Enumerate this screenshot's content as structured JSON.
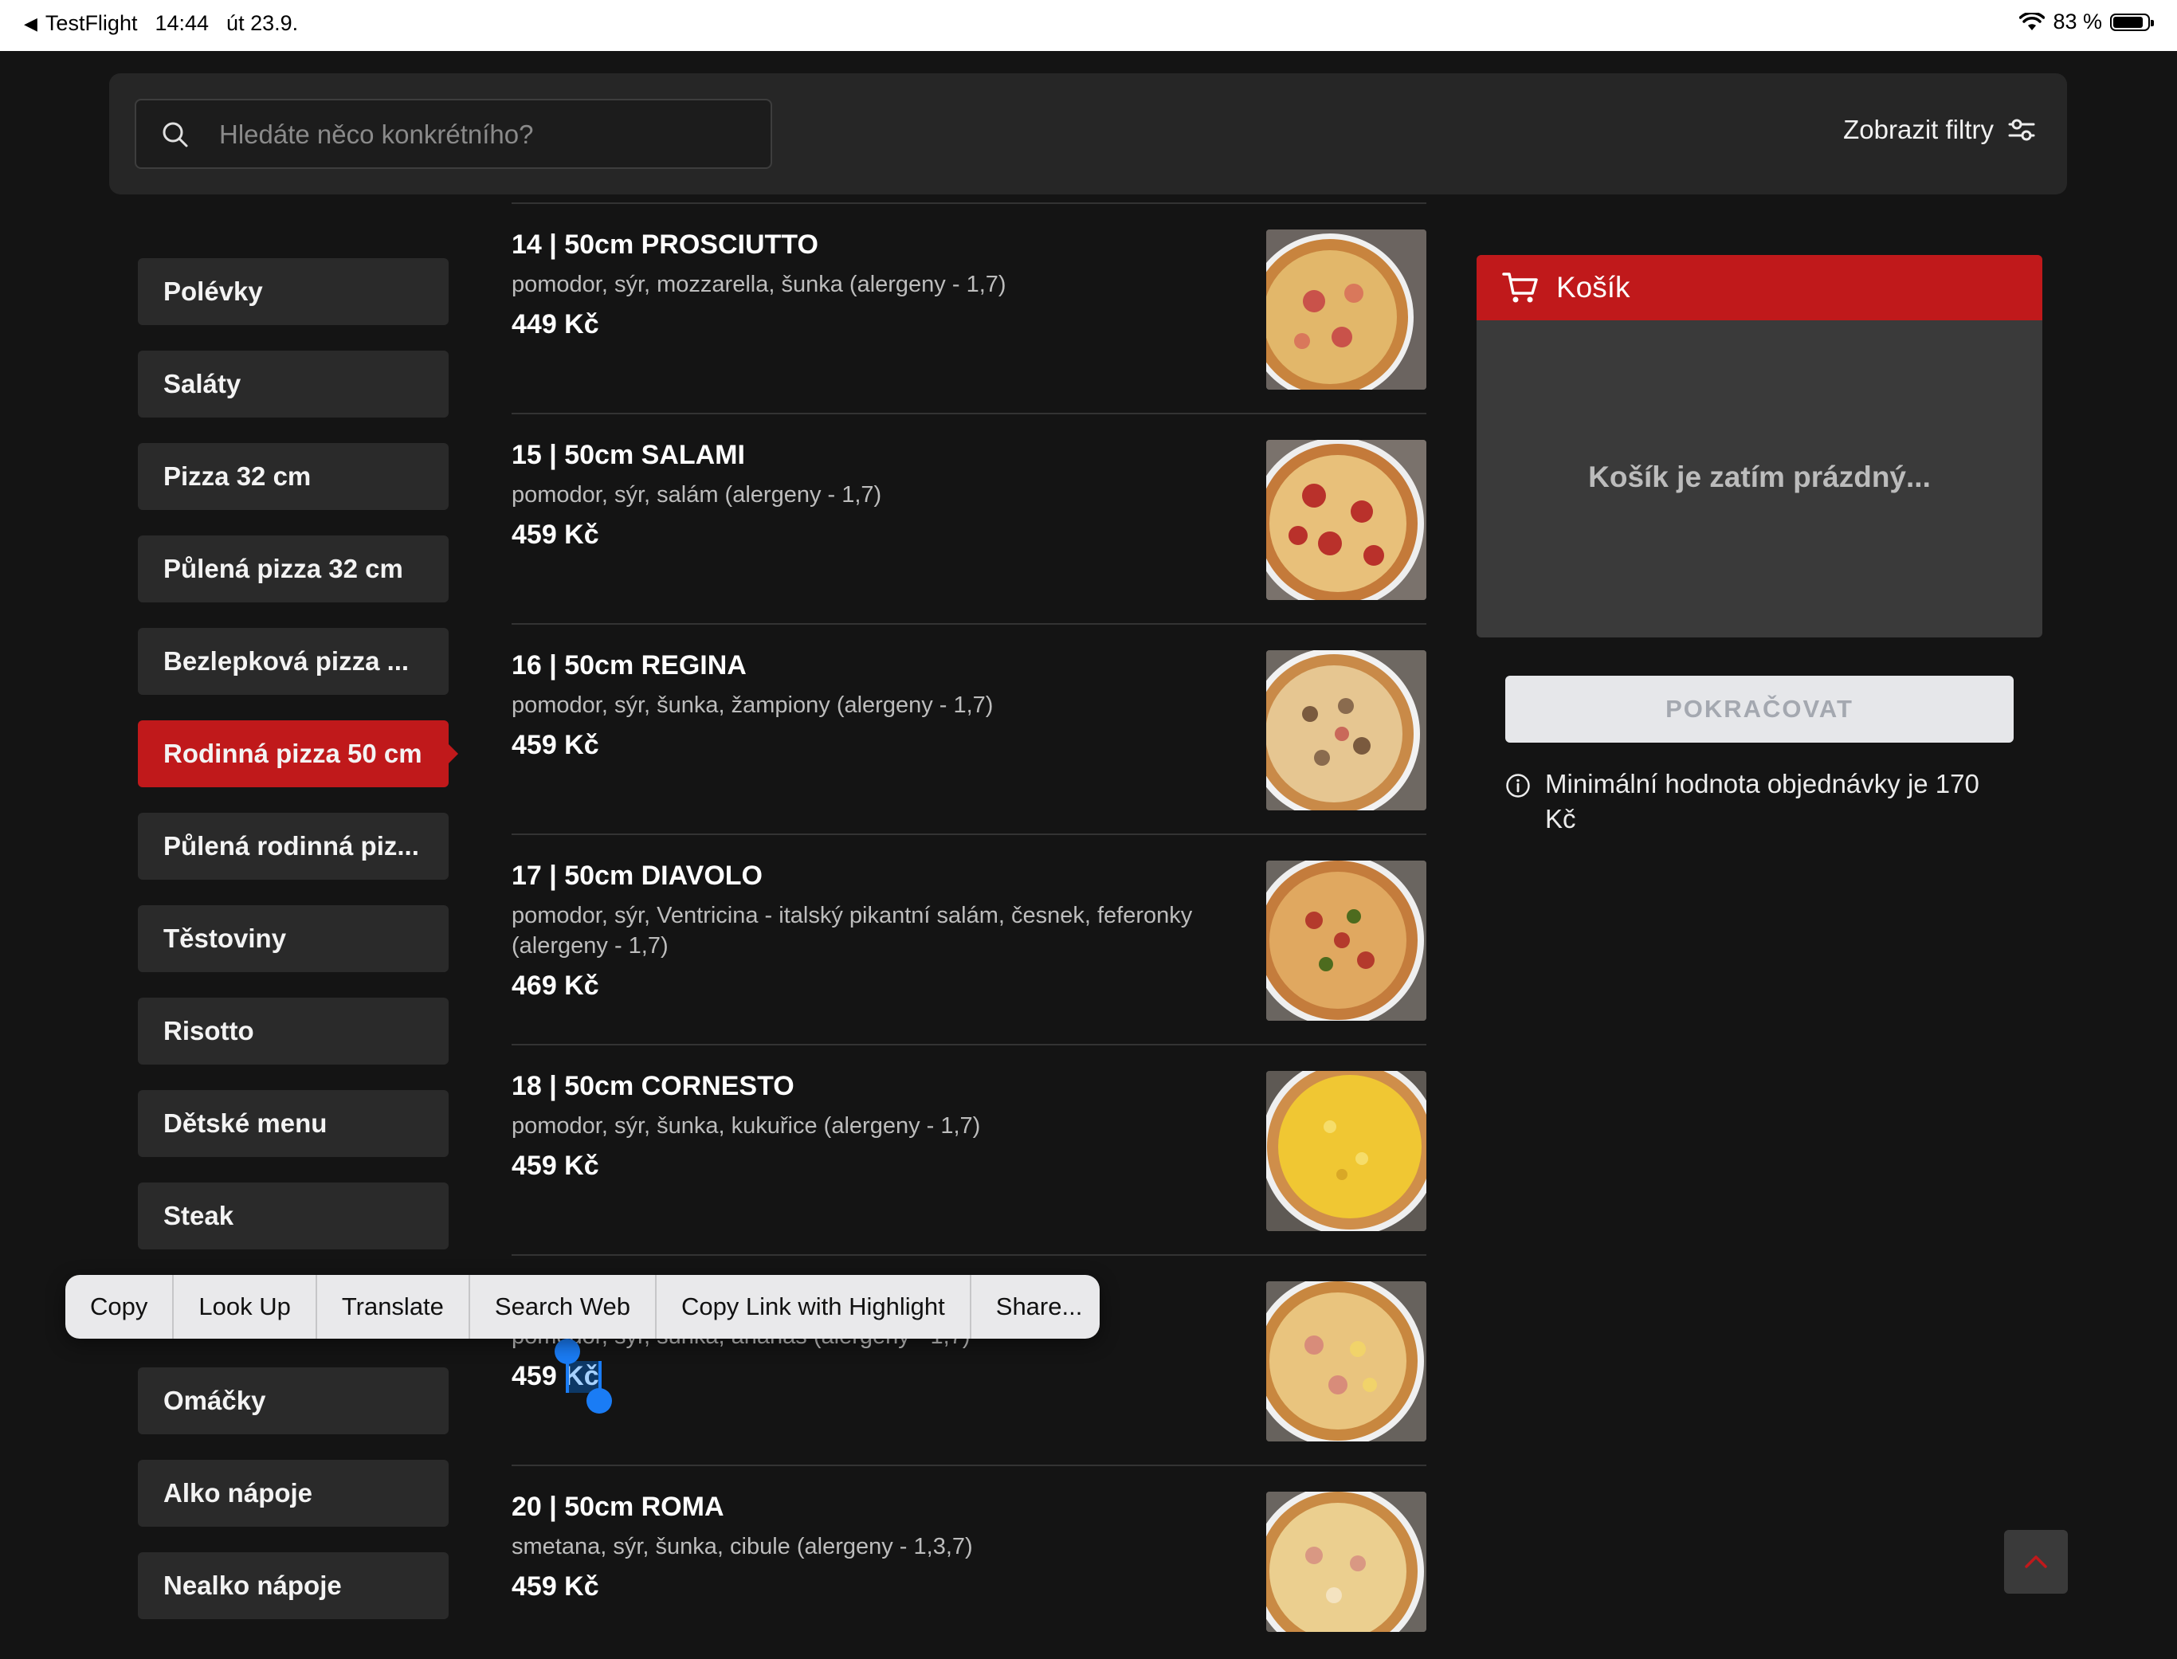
{
  "status_bar": {
    "back_app": "TestFlight",
    "time": "14:44",
    "date": "út 23.9.",
    "battery": "83 %"
  },
  "header": {
    "search_placeholder": "Hledáte něco konkrétního?",
    "filters_label": "Zobrazit filtry"
  },
  "categories": [
    {
      "label": "Polévky"
    },
    {
      "label": "Saláty"
    },
    {
      "label": "Pizza 32 cm"
    },
    {
      "label": "Půlená pizza 32 cm"
    },
    {
      "label": "Bezlepková pizza ..."
    },
    {
      "label": "Rodinná pizza 50 cm",
      "active": true
    },
    {
      "label": "Půlená rodinná piz..."
    },
    {
      "label": "Těstoviny"
    },
    {
      "label": "Risotto"
    },
    {
      "label": "Dětské menu"
    },
    {
      "label": "Steak"
    },
    {
      "label": "Omáčky"
    },
    {
      "label": "Alko nápoje"
    },
    {
      "label": "Nealko nápoje"
    }
  ],
  "products": [
    {
      "title": "14 | 50cm PROSCIUTTO",
      "desc": "pomodor, sýr, mozzarella, šunka (alergeny - 1,7)",
      "price": "449 Kč"
    },
    {
      "title": "15 | 50cm SALAMI",
      "desc": "pomodor, sýr, salám (alergeny - 1,7)",
      "price": "459 Kč"
    },
    {
      "title": "16 | 50cm REGINA",
      "desc": "pomodor, sýr, šunka, žampiony (alergeny - 1,7)",
      "price": "459 Kč"
    },
    {
      "title": "17 | 50cm DIAVOLO",
      "desc": "pomodor, sýr, Ventricina - italský pikantní salám, česnek, feferonky (alergeny - 1,7)",
      "price": "469 Kč"
    },
    {
      "title": "18 | 50cm CORNESTO",
      "desc": "pomodor, sýr, šunka, kukuřice (alergeny - 1,7)",
      "price": "459 Kč"
    },
    {
      "title": "",
      "desc": "pomodor, sýr, šunka, ananas (alergeny - 1,7)",
      "price": "459 Kč"
    },
    {
      "title": "20 | 50cm ROMA",
      "desc": "smetana, sýr, šunka, cibule (alergeny - 1,3,7)",
      "price": "459 Kč"
    }
  ],
  "cart": {
    "title": "Košík",
    "empty_text": "Košík je zatím prázdný...",
    "continue_label": "POKRAČOVAT",
    "min_note": "Minimální hodnota objednávky je 170 Kč"
  },
  "context_menu": [
    "Copy",
    "Look Up",
    "Translate",
    "Search Web",
    "Copy Link with Highlight",
    "Share..."
  ],
  "colors": {
    "accent": "#c0191b",
    "background": "#141414",
    "panel": "#262626"
  }
}
